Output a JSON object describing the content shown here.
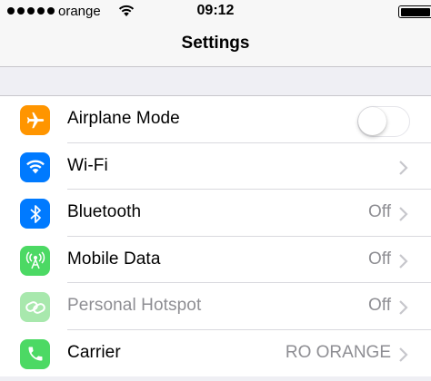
{
  "status_bar": {
    "carrier": "orange",
    "time": "09:12",
    "signal_bars": 5,
    "icons": [
      "signal-dots-icon",
      "wifi-icon",
      "battery-icon"
    ]
  },
  "nav": {
    "title": "Settings"
  },
  "settings": {
    "rows": [
      {
        "label": "Airplane Mode",
        "value": "",
        "icon": "airplane-icon",
        "icon_color": "#ff9500",
        "toggle": false,
        "disabled": false
      },
      {
        "label": "Wi-Fi",
        "value": "",
        "icon": "wifi-icon",
        "icon_color": "#007aff",
        "disabled": false
      },
      {
        "label": "Bluetooth",
        "value": "Off",
        "icon": "bluetooth-icon",
        "icon_color": "#007aff",
        "disabled": false
      },
      {
        "label": "Mobile Data",
        "value": "Off",
        "icon": "antenna-icon",
        "icon_color": "#4cd964",
        "disabled": false
      },
      {
        "label": "Personal Hotspot",
        "value": "Off",
        "icon": "hotspot-link-icon",
        "icon_color": "#a8e8ad",
        "disabled": true
      },
      {
        "label": "Carrier",
        "value": "RO ORANGE",
        "icon": "phone-icon",
        "icon_color": "#4cd964",
        "disabled": false
      }
    ]
  },
  "colors": {
    "background": "#efeff4",
    "separator": "#c8c7cc",
    "secondary_text": "#8e8e93"
  }
}
